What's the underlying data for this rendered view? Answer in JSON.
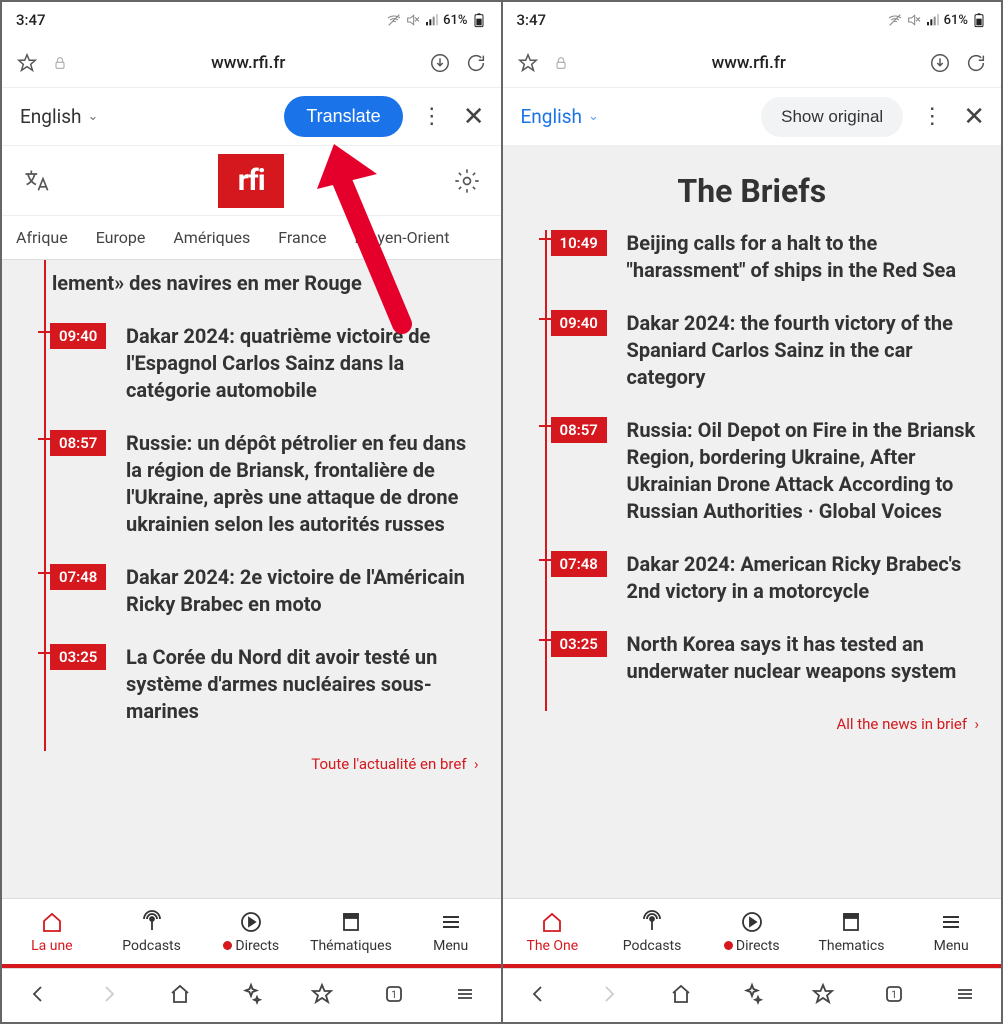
{
  "status": {
    "time": "3:47",
    "battery": "61%"
  },
  "browser": {
    "url": "www.rfi.fr"
  },
  "left": {
    "translate": {
      "language": "English",
      "button": "Translate"
    },
    "navTabs": [
      "Afrique",
      "Europe",
      "Amériques",
      "France",
      "Moyen-Orient"
    ],
    "briefs": [
      {
        "time": "",
        "partial": true,
        "headline": "lement» des navires en mer Rouge"
      },
      {
        "time": "09:40",
        "headline": "Dakar 2024: quatrième victoire de l'Espagnol Carlos Sainz dans la catégorie automobile"
      },
      {
        "time": "08:57",
        "headline": "Russie: un dépôt pétrolier en feu dans la région de Briansk, frontalière de l'Ukraine, après une attaque de drone ukrainien selon les autorités russes"
      },
      {
        "time": "07:48",
        "headline": "Dakar 2024: 2e victoire de l'Américain Ricky Brabec en moto"
      },
      {
        "time": "03:25",
        "headline": "La Corée du Nord dit avoir testé un système d'armes nucléaires sous-marines"
      }
    ],
    "moreLink": "Toute l'actualité en bref",
    "appNav": [
      "La une",
      "Podcasts",
      "Directs",
      "Thématiques",
      "Menu"
    ]
  },
  "right": {
    "translate": {
      "language": "English",
      "button": "Show original"
    },
    "sectionTitle": "The Briefs",
    "briefs": [
      {
        "time": "10:49",
        "headline": "Beijing calls for a halt to the \"harassment\" of ships in the Red Sea"
      },
      {
        "time": "09:40",
        "headline": "Dakar 2024: the fourth victory of the Spaniard Carlos Sainz in the car category"
      },
      {
        "time": "08:57",
        "headline": "Russia: Oil Depot on Fire in the Briansk Region, bordering Ukraine, After Ukrainian Drone Attack According to Russian Authorities · Global Voices"
      },
      {
        "time": "07:48",
        "headline": "Dakar 2024: American Ricky Brabec's 2nd victory in a motorcycle"
      },
      {
        "time": "03:25",
        "headline": "North Korea says it has tested an underwater nuclear weapons system"
      }
    ],
    "moreLink": "All the news in brief",
    "appNav": [
      "The One",
      "Podcasts",
      "Directs",
      "Thematics",
      "Menu"
    ]
  }
}
